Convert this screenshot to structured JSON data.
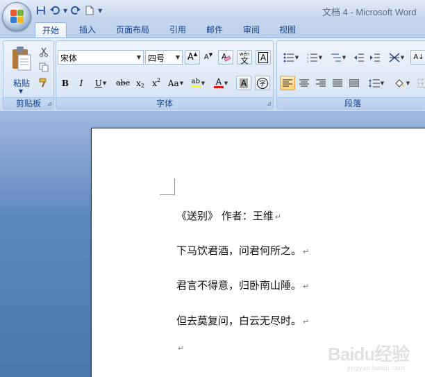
{
  "window": {
    "title": "文档 4 - Microsoft Word"
  },
  "quick_access": {
    "icons": [
      "save-icon",
      "undo-icon",
      "redo-icon",
      "new-document-icon",
      "customize-icon"
    ]
  },
  "tabs": [
    {
      "label": "开始",
      "active": true
    },
    {
      "label": "插入",
      "active": false
    },
    {
      "label": "页面布局",
      "active": false
    },
    {
      "label": "引用",
      "active": false
    },
    {
      "label": "邮件",
      "active": false
    },
    {
      "label": "审阅",
      "active": false
    },
    {
      "label": "视图",
      "active": false
    }
  ],
  "ribbon": {
    "clipboard": {
      "label": "剪贴板",
      "paste_label": "粘贴"
    },
    "font": {
      "label": "字体",
      "font_name": "宋体",
      "font_size": "四号",
      "bold": "B",
      "italic": "I",
      "underline": "U",
      "strike": "abc",
      "subscript": "x",
      "superscript": "x",
      "change_case": "Aa",
      "clear_format_glyph": "A",
      "phonetic_glyph": "wén",
      "phonetic_char": "文",
      "char_border_glyph": "A",
      "char_shade_glyph": "A",
      "enclose_glyph": "字",
      "highlight_glyph": "ab",
      "font_color_glyph": "A"
    },
    "paragraph": {
      "label": "段落",
      "sort_glyph": "A"
    }
  },
  "document": {
    "paragraphs": [
      "《送别》 作者：王维",
      "下马饮君酒，问君何所之。",
      "君言不得意，归卧南山陲。",
      "但去莫复问，白云无尽时。",
      ""
    ],
    "paragraph_mark": "↵"
  },
  "watermark": {
    "brand": "Baidu经验",
    "url": "jingyan.baidu.com"
  },
  "colors": {
    "highlight": "#ffff00",
    "font_color": "#e01010",
    "accent": "#15428b"
  }
}
